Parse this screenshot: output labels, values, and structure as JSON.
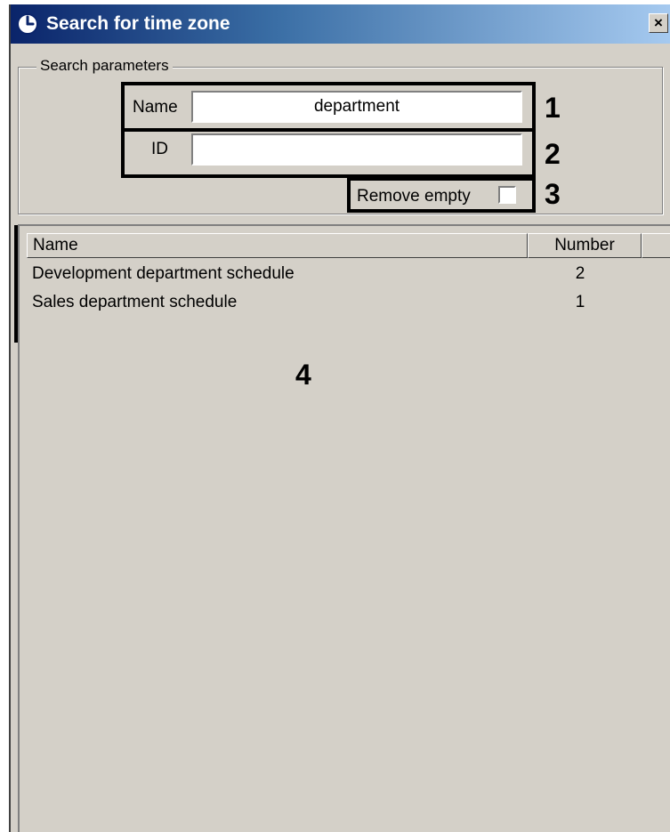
{
  "window": {
    "title": "Search for time zone",
    "close_label": "×"
  },
  "search_parameters": {
    "legend": "Search parameters",
    "name_label": "Name",
    "name_value": "department",
    "id_label": "ID",
    "id_value": "",
    "remove_empty_label": "Remove empty",
    "remove_empty_checked": false
  },
  "results": {
    "columns": [
      "Name",
      "Number"
    ],
    "rows": [
      {
        "name": "Development department schedule",
        "number": "2"
      },
      {
        "name": "Sales department schedule",
        "number": "1"
      }
    ]
  },
  "callouts": [
    "1",
    "2",
    "3",
    "4"
  ],
  "icons": {
    "title": "clock-icon",
    "close": "close-icon"
  }
}
